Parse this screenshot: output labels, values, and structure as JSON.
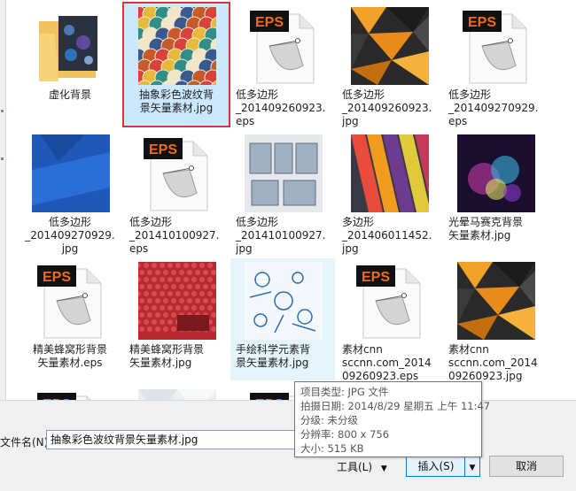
{
  "files": [
    {
      "label": "虚化背景",
      "kind": "folder"
    },
    {
      "label": "抽象彩色波纹背\n景矢量素材.jpg",
      "kind": "waves",
      "selected": true
    },
    {
      "label": "低多边形\n_201409260923.\neps",
      "kind": "eps",
      "badge": "EPS"
    },
    {
      "label": "低多边形\n_201409260923.\njpg",
      "kind": "poly-dark"
    },
    {
      "label": "低多边形\n_201409270929.\neps",
      "kind": "eps",
      "badge": "EPS"
    },
    {
      "label": "低多边形\n_201409270929.\njpg",
      "kind": "blue"
    },
    {
      "label": "低多边形\n_201410100927.\neps",
      "kind": "eps",
      "badge": "EPS"
    },
    {
      "label": "低多边形\n_201410100927.\njpg",
      "kind": "cards"
    },
    {
      "label": "多边形\n_201406011452.\njpg",
      "kind": "stripes"
    },
    {
      "label": "光晕马赛克背景\n矢量素材.jpg",
      "kind": "glow"
    },
    {
      "label": "精美蜂窝形背景\n矢量素材.eps",
      "kind": "eps",
      "badge": "EPS"
    },
    {
      "label": "精美蜂窝形背景\n矢量素材.jpg",
      "kind": "honeycomb"
    },
    {
      "label": "手绘科学元素背\n景矢量素材.jpg",
      "kind": "science",
      "hover": true
    },
    {
      "label": "素材cnn\nsccnn.com_2014\n09260923.eps",
      "kind": "eps",
      "badge": "EPS"
    },
    {
      "label": "素材cnn\nsccnn.com_2014\n09260923.jpg",
      "kind": "poly-dark"
    },
    {
      "label": "",
      "kind": "eps",
      "badge": "EPS"
    },
    {
      "label": "",
      "kind": "white-poly"
    },
    {
      "label": "",
      "kind": "eps",
      "badge": "EPS"
    }
  ],
  "filename": {
    "label": "文件名(N):",
    "value": "抽象彩色波纹背景矢量素材.jpg"
  },
  "buttons": {
    "tools": "工具(L)",
    "insert": "插入(S)",
    "cancel": "取消"
  },
  "tooltip": {
    "type": "项目类型: JPG 文件",
    "date": "拍摄日期: 2014/8/29 星期五 上午 11:47",
    "rating": "分级: 未分级",
    "resolution": "分辨率: 800 x 756",
    "size": "大小: 515 KB"
  },
  "colors": {
    "eps_badge": "#111111",
    "eps_text": "#f26a1b",
    "selection_border": "#d0383a",
    "selection_fill": "#cce8ff",
    "hover_fill": "#e5f3fb"
  }
}
